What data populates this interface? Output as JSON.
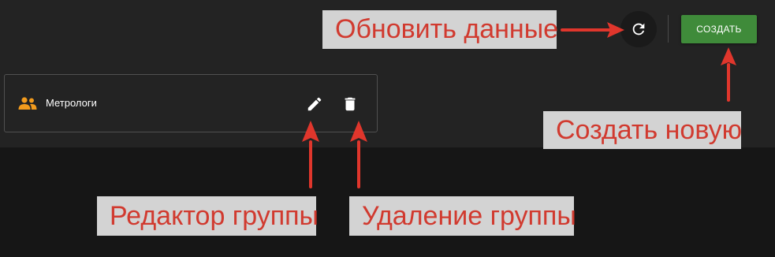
{
  "toolbar": {
    "refresh_icon": "refresh-icon",
    "create_label": "СОЗДАТЬ"
  },
  "groups": [
    {
      "name": "Метрологи",
      "icon": "group-icon",
      "accent_color": "#f29b1d"
    }
  ],
  "annotations": {
    "refresh": "Обновить данные",
    "create": "Создать новую",
    "edit": "Редактор группы",
    "delete": "Удаление группы"
  },
  "colors": {
    "panel": "#232323",
    "background": "#161616",
    "create_button": "#3f8b3a",
    "callout_background": "#d3d3d3",
    "callout_text": "#d13a2f"
  }
}
